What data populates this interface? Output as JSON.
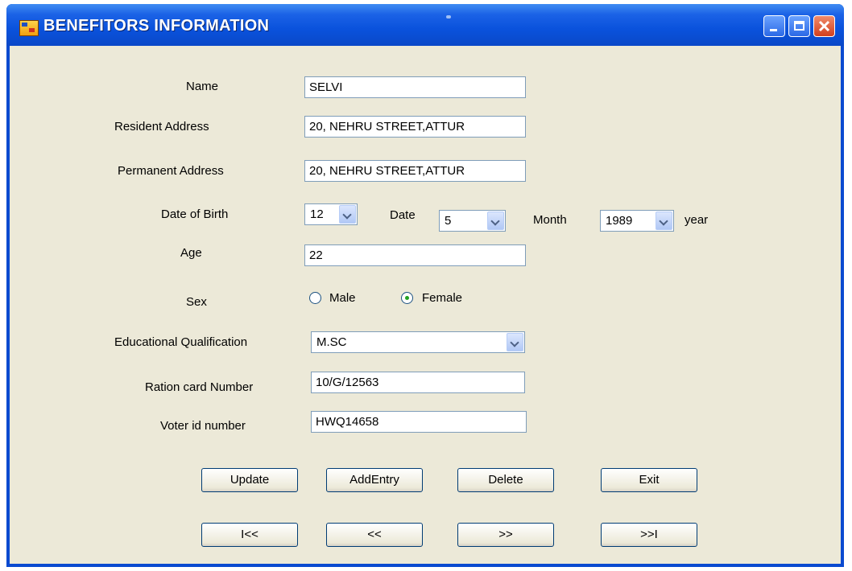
{
  "window": {
    "title": "BENEFITORS INFORMATION"
  },
  "form": {
    "name_label": "Name",
    "name_value": "SELVI",
    "resident_label": "Resident Address",
    "resident_value": "20, NEHRU STREET,ATTUR",
    "permanent_label": "Permanent Address",
    "permanent_value": "20, NEHRU STREET,ATTUR",
    "dob_label": "Date of Birth",
    "dob_day": "12",
    "dob_day_label": "Date",
    "dob_month": "5",
    "dob_month_label": "Month",
    "dob_year": "1989",
    "dob_year_label": "year",
    "age_label": "Age",
    "age_value": "22",
    "sex_label": "Sex",
    "sex_options": [
      "Male",
      "Female"
    ],
    "sex_selected": "Female",
    "edu_label": "Educational Qualification",
    "edu_value": "M.SC",
    "ration_label": "Ration card Number",
    "ration_value": "10/G/12563",
    "voter_label": "Voter id number",
    "voter_value": "HWQ14658"
  },
  "buttons": {
    "update": "Update",
    "add": "AddEntry",
    "delete": "Delete",
    "exit": "Exit",
    "first": "I<<",
    "prev": "<<",
    "next": ">>",
    "last": ">>I"
  }
}
